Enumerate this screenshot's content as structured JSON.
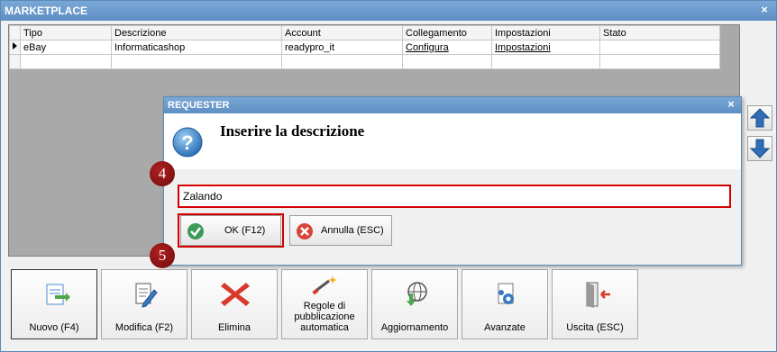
{
  "window": {
    "title": "MARKETPLACE",
    "close_glyph": "×"
  },
  "grid": {
    "columns": [
      "Tipo",
      "Descrizione",
      "Account",
      "Collegamento",
      "Impostazioni",
      "Stato"
    ],
    "rows": [
      {
        "tipo": "eBay",
        "descrizione": "Informaticashop",
        "account": "readypro_it",
        "collegamento": "Configura",
        "impostazioni": "Impostazioni",
        "stato": ""
      }
    ]
  },
  "side_buttons": {
    "up_icon": "arrow-up-icon",
    "down_icon": "arrow-down-icon"
  },
  "toolbar": {
    "nuovo": "Nuovo (F4)",
    "modifica": "Modifica (F2)",
    "elimina": "Elimina",
    "regole": "Regole di pubblicazione automatica",
    "aggiornamento": "Aggiornamento",
    "avanzate": "Avanzate",
    "uscita": "Uscita (ESC)"
  },
  "dialog": {
    "title": "REQUESTER",
    "message": "Inserire la descrizione",
    "input_value": "Zalando",
    "ok_label": "OK (F12)",
    "cancel_label": "Annulla (ESC)"
  },
  "annotations": {
    "step_4": "4",
    "step_5": "5"
  },
  "colors": {
    "titlebar": "#6b9bcf",
    "highlight": "#d40000",
    "badge": "#8b1414"
  }
}
